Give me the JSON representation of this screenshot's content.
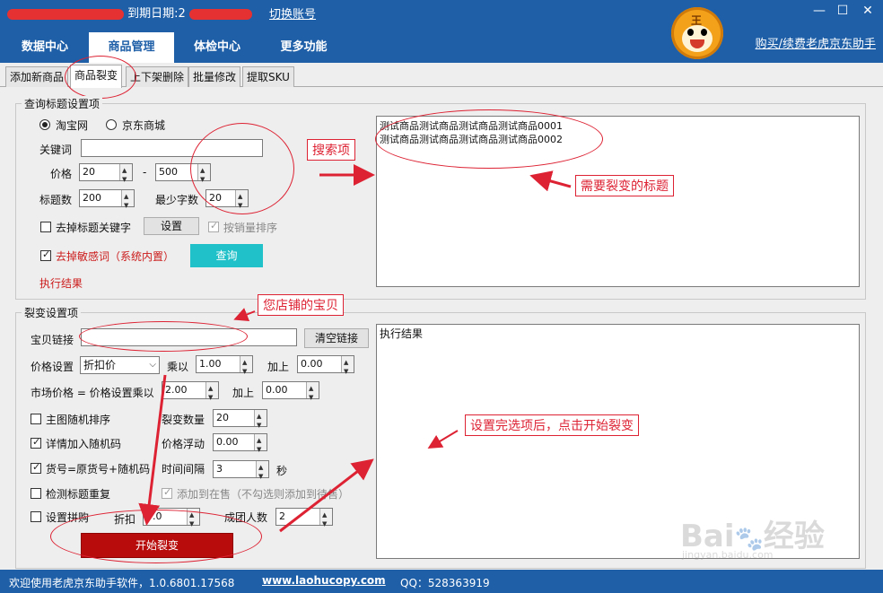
{
  "header": {
    "expiry_label": "到期日期:2",
    "switch_account": "切换账号",
    "buy_link": "购买/续费老虎京东助手",
    "tiger_text": "王",
    "window_buttons": [
      "—",
      "☐",
      "✕"
    ]
  },
  "main_tabs": [
    {
      "label": "数据中心"
    },
    {
      "label": "商品管理"
    },
    {
      "label": "体检中心"
    },
    {
      "label": "更多功能"
    }
  ],
  "sub_tabs": [
    {
      "label": "添加新商品"
    },
    {
      "label": "商品裂变"
    },
    {
      "label": "上下架删除"
    },
    {
      "label": "批量修改"
    },
    {
      "label": "提取SKU"
    }
  ],
  "query_group": {
    "title": "查询标题设置项",
    "radio_taobao": "淘宝网",
    "radio_jd": "京东商城",
    "keyword_label": "关键词",
    "keyword_value": "",
    "price_label": "价格",
    "price_min": "20",
    "price_dash": "-",
    "price_max": "500",
    "title_count_label": "标题数",
    "title_count_value": "200",
    "min_words_label": "最少字数",
    "min_words_value": "20",
    "remove_keywords_label": "去掉标题关键字",
    "settings_button": "设置",
    "sort_by_sales_label": "按销量排序",
    "remove_sensitive_label": "去掉敏感词（系统内置）",
    "query_button": "查询",
    "result_label": "执行结果",
    "titles": [
      "测试商品测试商品测试商品测试商品0001",
      "测试商品测试商品测试商品测试商品0002"
    ]
  },
  "fission_group": {
    "title": "裂变设置项",
    "link_label": "宝贝链接",
    "link_value": "",
    "clear_button": "清空链接",
    "price_setting_label": "价格设置",
    "price_setting_value": "折扣价",
    "multiply_label": "乘以",
    "multiply_value": "1.00",
    "add_label": "加上",
    "add_value": "0.00",
    "market_price_label": "市场价格 = 价格设置乘以",
    "market_multiply_value": "2.00",
    "market_add_label": "加上",
    "market_add_value": "0.00",
    "random_main_image": "主图随机排序",
    "fission_count_label": "裂变数量",
    "fission_count_value": "20",
    "detail_random_code": "详情加入随机码",
    "price_float_label": "价格浮动",
    "price_float_value": "0.00",
    "sku_random": "货号=原货号+随机码",
    "interval_label": "时间间隔",
    "interval_value": "3",
    "interval_unit": "秒",
    "check_title_dup": "检测标题重复",
    "add_on_sale": "添加到在售（不勾选则添加到待售）",
    "set_group_buy": "设置拼购",
    "discount_label": "折扣",
    "discount_value": "9.0",
    "group_people_label": "成团人数",
    "group_people_value": "2",
    "start_button": "开始裂变",
    "result_text": "执行结果"
  },
  "annotations": {
    "search_items": "搜索项",
    "titles_to_fission": "需要裂变的标题",
    "your_store_items": "您店铺的宝贝",
    "after_setup": "设置完选项后，点击开始裂变"
  },
  "footer": {
    "welcome": "欢迎使用老虎京东助手软件，1.0.6801.17568",
    "website": "www.laohucopy.com",
    "qq": "QQ：528363919"
  },
  "watermark": {
    "brand": "Bai",
    "brand2": "经验",
    "url": "jingyan.baidu.com"
  },
  "colors": {
    "header_blue": "#1e5fa8",
    "annotation_red": "#dd2233",
    "query_teal": "#20c1c8",
    "start_red": "#b80b0b"
  }
}
